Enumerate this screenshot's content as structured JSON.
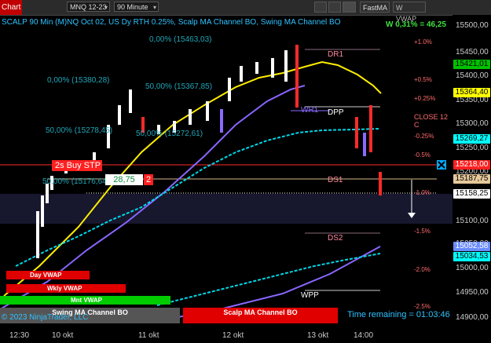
{
  "toolbar": {
    "chart_tab": "Chart",
    "instrument": "MNQ 12-23",
    "period": "90 Minute",
    "fastma": "FastMA",
    "wvwap": "W VWAP"
  },
  "chart": {
    "title": "SCALP 90 Min (M)NQ Oct 02, US Dy RTH 0.25%, Scalp MA Channel BO, Swing MA Channel BO",
    "performance": "W 0,31% = 46,25",
    "copyright": "© 2023 NinjaTrader, LLC",
    "time_remaining": "Time remaining = 01:03:46"
  },
  "fib_labels": [
    "0,00% (15463,03)",
    "0,00% (15380,28)",
    "50,00% (15367,85)",
    "50,00% (15278,45)",
    "50,00% (15272,61)",
    "50,00% (15176,64)"
  ],
  "pct_labels": [
    "+1.0%",
    "+0.5%",
    "+0.25%",
    "-0.25%",
    "-0.5%",
    "-1.0%",
    "-1.5%",
    "-2.0%",
    "-2.5%"
  ],
  "levels": {
    "dr1": "DR1",
    "dpp": "DPP",
    "wr1": "WR1",
    "close": "CLOSE 12 C",
    "ds1": "DS1",
    "ds2": "DS2",
    "wpp": "WPP"
  },
  "trade": {
    "signal": "2s Buy STP",
    "price": "28,75",
    "qty": "2"
  },
  "vwap_flags": {
    "day": "Day VWAP",
    "weekly": "Wkly VWAP",
    "monthly": "Mnt VWAP"
  },
  "bottom_bars": {
    "swing": "Swing MA Channel BO",
    "scalp": "Scalp MA Channel BO"
  },
  "price_axis": {
    "ticks": [
      "15500,00",
      "15450,00",
      "15400,00",
      "15350,00",
      "15300,00",
      "15250,00",
      "15200,00",
      "15150,00",
      "15100,00",
      "15050,00",
      "15000,00",
      "14950,00",
      "14900,00"
    ],
    "tags": [
      {
        "label": "15421,01",
        "bg": "#00c000",
        "fg": "#000"
      },
      {
        "label": "15364,40",
        "bg": "#ffff00",
        "fg": "#000"
      },
      {
        "label": "15269,27",
        "bg": "#00ffff",
        "fg": "#000"
      },
      {
        "label": "15218,00",
        "bg": "#ff2020",
        "fg": "#fff"
      },
      {
        "label": "15187,75",
        "bg": "#e6c89a",
        "fg": "#000"
      },
      {
        "label": "15158,25",
        "bg": "#ffffff",
        "fg": "#000"
      },
      {
        "label": "15052,58",
        "bg": "#6a8cff",
        "fg": "#fff"
      },
      {
        "label": "15034,53",
        "bg": "#00ffff",
        "fg": "#000"
      }
    ]
  },
  "time_axis": [
    "12:30",
    "10 okt",
    "11 okt",
    "12 okt",
    "13 okt",
    "14:00"
  ],
  "colors": {
    "background": "#000000",
    "title": "#2fc2ff",
    "bull_candle": "#ffffff",
    "bear_candle": "#ff2a2a",
    "fast_ma": "#ffee00",
    "slow_ma": "#8866ff",
    "channel": "#00d8e8"
  }
}
